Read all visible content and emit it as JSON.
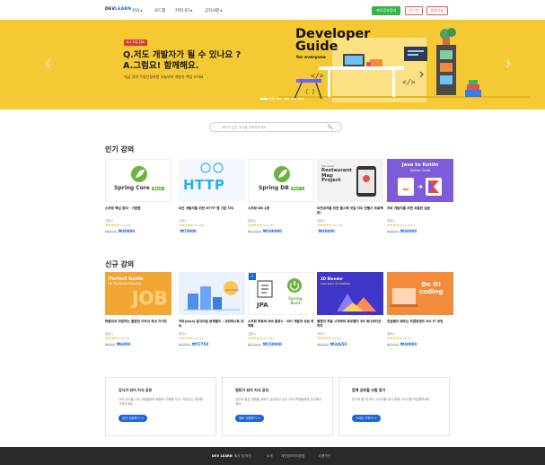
{
  "header": {
    "logo_part1": "DEV",
    "logo_part2": "LEARN",
    "nav": [
      {
        "label": "강의"
      },
      {
        "label": "로드맵"
      },
      {
        "label": "커뮤니티"
      },
      {
        "label": "공지사항"
      }
    ],
    "apply_label": "지식공유참여",
    "login_label": "로그인",
    "signup_label": "회원가입"
  },
  "banner": {
    "badge": "6.4 오픈 완료",
    "title_line1": "Q.저도 개발자가 될 수 있나요 ?",
    "title_line2": "A.그럼요! 함께해요.",
    "subtitle": "지금 강의 수강신청하면 오늘부터 개발자 핵심 드려요",
    "guide_title_line1": "Developer",
    "guide_title_line2": "Guide",
    "guide_subtitle": "for everyone",
    "colors": {
      "background": "#f5c933",
      "badge": "#d63b36"
    }
  },
  "search": {
    "placeholder": "배우고 싶은 지식을 입력해보세요"
  },
  "popular": {
    "title": "인기 강의",
    "courses": [
      {
        "thumb_text": "Spring Core",
        "thumb_tag": "Basic",
        "title": "스프링 핵심 원리 - 기본편",
        "instructor": "김영시",
        "stars": "★★★★★",
        "count": "4.9 (35)",
        "old_price": "₩88000",
        "price": "₩40000"
      },
      {
        "thumb_text": "HTTP",
        "title": "모든 개발자를 위한 HTTP 웹 기본 지식",
        "instructor": "나영시",
        "stars": "★★★★★",
        "count": "4.9 (40)",
        "old_price": "",
        "price": "₩70000"
      },
      {
        "thumb_text": "Spring DB",
        "thumb_tag": "Part 1",
        "title": "스프링 DB 1편",
        "instructor": "황영시",
        "stars": "★★★★★",
        "count": "4.9 (40)",
        "old_price": "₩120000",
        "price": "₩100000"
      },
      {
        "thumb_text_1": "Full-stack",
        "thumb_text_2": "Restaurant",
        "thumb_text_3": "Map",
        "thumb_text_4": "Project",
        "title": "비전공자를 위한 풀스택 맛집 지도 만들기 프로젝트!",
        "instructor": "김영시",
        "stars": "★★★★★",
        "count": "4.9 (15)",
        "old_price": "",
        "price": "₩40000"
      },
      {
        "thumb_text_1": "Java to Kotlin",
        "thumb_text_2": "Starter Guide",
        "title": "자바 개발자를 위한 코틀린 입문",
        "instructor": "최영시",
        "stars": "★★★★★",
        "count": "4.9 (40)",
        "old_price": "₩48000",
        "price": "₩40000"
      }
    ]
  },
  "new": {
    "title": "신규 강의",
    "courses": [
      {
        "thumb_text_1": "Perfect Guide",
        "thumb_text_2": "for Publisher Resume",
        "thumb_text_3": "JOB",
        "title": "퍼블리셔 취업하는 플롯한 이력서 작성 가이드",
        "instructor": "정영시",
        "stars": "★★★★★",
        "count": "4.9 (4)",
        "old_price": "₩8800",
        "price": "₩6000"
      },
      {
        "thumb_text": "Algorithm",
        "title": "자바(Java) 알고리즘 문제풀이 : 코딩테스트 대비",
        "instructor": "윤영시",
        "stars": "★★★★★",
        "count": "4.9 (7)",
        "old_price": "₩77000",
        "price": "₩57750"
      },
      {
        "thumb_num": "1",
        "thumb_text_1": "JPA",
        "thumb_text_2": "Spring",
        "thumb_text_3": "Boot",
        "title": "스프링 부트와 JPA 활용2 - API 개발과 성능 최적화",
        "instructor": "김영시",
        "stars": "★★★★★",
        "count": "4.9 (45)",
        "old_price": "₩120000",
        "price": "₩150000"
      },
      {
        "thumb_text_1": "3D Blender",
        "thumb_text_2": "Low-poly Animation",
        "title": "블렌더 처음 시작부터 로우폴리 3D 애니메이션 까지",
        "instructor": "조영시",
        "stars": "★★★★★",
        "count": "4.9 (5)",
        "old_price": "₩40000",
        "price": "₩34650"
      },
      {
        "thumb_text_1": "Do it!",
        "thumb_text_2": "coding",
        "title": "전설쌤이 배우는 프론트엔드 DO IT 코딩",
        "instructor": "정영시",
        "stars": "★★★★★",
        "count": "4.9 (3)",
        "old_price": "₩72000",
        "price": "₩40000"
      }
    ]
  },
  "promo": [
    {
      "title": "강사가 되어 지식 공유",
      "desc": "나의 지식을 나눠 사람들에게 배움의 기회를 주고, 의미있는 대가를 가져가세요.",
      "button": "강사 신청하기 ➔"
    },
    {
      "title": "멘토가 되어 지식 공유",
      "desc": "실무로 쌓은 경험을 새로이 공유하고 있는 여러 학생들에게 전수해주세요.",
      "button": "멘토 신청하기 ➔"
    },
    {
      "title": "함께 공부할 사람 찾기",
      "desc": "혼자서 할 때 보다 시너지를 내기 위해 스터디를 모집해보세요.",
      "button": "스터디 구하기 ➔"
    }
  ],
  "footer": {
    "logo": "DEV LEARN",
    "links": [
      "회사 및 약관",
      "소개",
      "개인정보처리방침",
      "이용약관"
    ]
  }
}
